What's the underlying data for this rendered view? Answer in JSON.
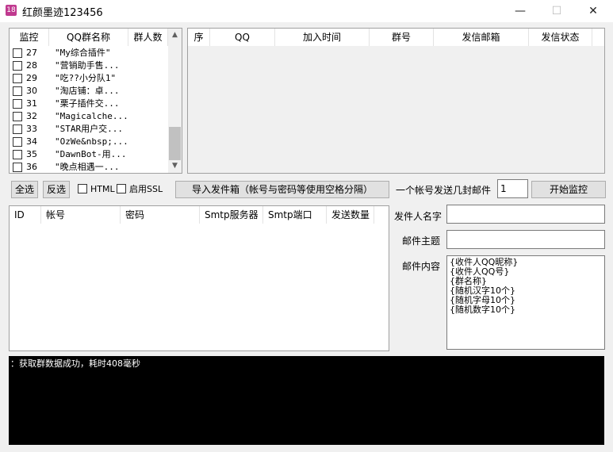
{
  "window": {
    "title": "红颜墨迹123456",
    "icon": "app-logo-icon",
    "minimize_glyph": "—",
    "maximize_glyph": "☐",
    "close_glyph": "✕"
  },
  "group_list": {
    "headers": [
      "监控",
      "QQ群名称",
      "群人数"
    ],
    "rows": [
      {
        "num": "27",
        "name": "\"My综合插件\""
      },
      {
        "num": "28",
        "name": "\"营销助手售..."
      },
      {
        "num": "29",
        "name": "\"吃??小分队1\""
      },
      {
        "num": "30",
        "name": "\"淘店铺：卓..."
      },
      {
        "num": "31",
        "name": "\"栗子插件交..."
      },
      {
        "num": "32",
        "name": "\"Magicalche..."
      },
      {
        "num": "33",
        "name": "\"STAR用户交..."
      },
      {
        "num": "34",
        "name": "\"OzWe&nbsp;..."
      },
      {
        "num": "35",
        "name": "\"DawnBot-用..."
      },
      {
        "num": "36",
        "name": "\"晚点相遇一..."
      }
    ]
  },
  "member_table": {
    "headers": [
      "序",
      "QQ",
      "加入时间",
      "群号",
      "发信邮箱",
      "发信状态"
    ]
  },
  "controls": {
    "select_all": "全选",
    "invert": "反选",
    "html_label": "HTML",
    "ssl_label": "启用SSL",
    "import_button": "导入发件箱（帐号与密码等使用空格分隔）",
    "per_account_label": "一个帐号发送几封邮件",
    "per_account_value": "1",
    "start_button": "开始监控"
  },
  "account_table": {
    "headers": [
      "ID",
      "帐号",
      "密码",
      "Smtp服务器",
      "Smtp端口",
      "发送数量"
    ]
  },
  "mail_form": {
    "sender_label": "发件人名字",
    "sender_value": "",
    "subject_label": "邮件主题",
    "subject_value": "",
    "content_label": "邮件内容",
    "content_value": "{收件人QQ昵称}\n{收件人QQ号}\n{群名称}\n{随机汉字10个}\n{随机字母10个}\n{随机数字10个}"
  },
  "console": {
    "log": "：获取群数据成功，耗时408毫秒"
  }
}
